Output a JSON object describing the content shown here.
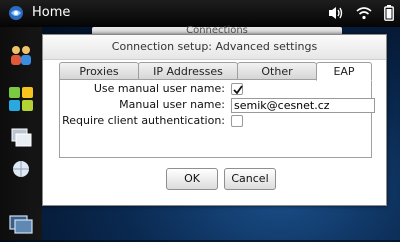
{
  "statusbar": {
    "home_label": "Home",
    "icons": [
      "volume-icon",
      "wifi-icon",
      "battery-icon"
    ]
  },
  "sidebar": {
    "icons": [
      "contacts-icon",
      "app-menu-icon",
      "task-switcher-icon",
      "globe-icon",
      "dashboard-icon"
    ]
  },
  "background_window": {
    "title": "Connections"
  },
  "dialog": {
    "title": "Connection setup: Advanced settings",
    "tabs": [
      {
        "label": "Proxies"
      },
      {
        "label": "IP Addresses"
      },
      {
        "label": "Other"
      },
      {
        "label": "EAP"
      }
    ],
    "active_tab": "EAP",
    "fields": {
      "use_manual_user_name": {
        "label": "Use manual user name:",
        "checked": true
      },
      "manual_user_name": {
        "label": "Manual user name:",
        "value": "semik@cesnet.cz"
      },
      "require_client_auth": {
        "label": "Require client authentication:",
        "checked": false
      }
    },
    "buttons": {
      "ok": "OK",
      "cancel": "Cancel"
    }
  },
  "colors": {
    "statusbar_bg": "#0a0a0a",
    "accent_blue": "#1a4f8a",
    "dialog_bg": "#ffffff"
  }
}
